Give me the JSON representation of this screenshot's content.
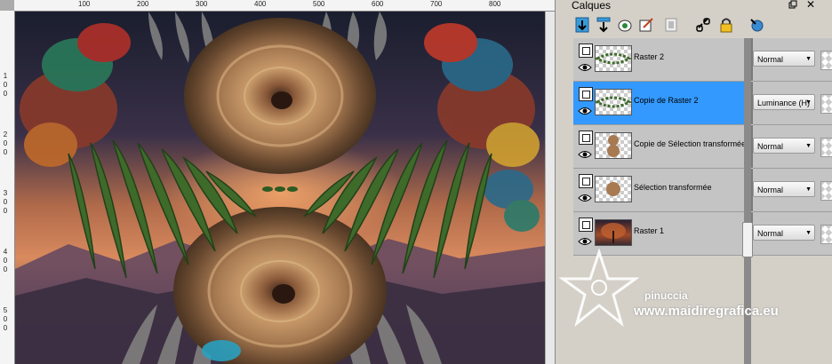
{
  "panel": {
    "title": "Calques",
    "window_icons": [
      "restore-icon",
      "close-icon"
    ]
  },
  "toolbar": {
    "tools": [
      "new-raster-layer-icon",
      "new-vector-layer-icon",
      "mask-icon",
      "adjustment-layer-icon",
      "delete-layer-icon",
      "link-icon",
      "lock-icon",
      "layer-styles-icon"
    ]
  },
  "layers": [
    {
      "name": "Raster 2",
      "blend": "Normal",
      "selected": false
    },
    {
      "name": "Copie de Raster 2",
      "blend": "Luminance (H)",
      "selected": true
    },
    {
      "name": "Copie de Sélection transformée",
      "blend": "Normal",
      "selected": false
    },
    {
      "name": "Sélection transformée",
      "blend": "Normal",
      "selected": false
    },
    {
      "name": "Raster 1",
      "blend": "Normal",
      "selected": false
    }
  ],
  "ruler": {
    "top_labels": [
      "100",
      "200",
      "300",
      "400",
      "500",
      "600",
      "700",
      "800"
    ],
    "left_labels": [
      "1",
      "0",
      "0",
      "2",
      "0",
      "0",
      "3",
      "0",
      "0",
      "4",
      "0",
      "0",
      "5",
      "0",
      "0"
    ]
  },
  "watermark": {
    "name": "pinuccia",
    "url": "www.maidiregrafica.eu"
  },
  "colors": {
    "selected_row": "#3399ff",
    "row_bg": "#c4c4c4",
    "panel_bg": "#d4d0c8"
  }
}
